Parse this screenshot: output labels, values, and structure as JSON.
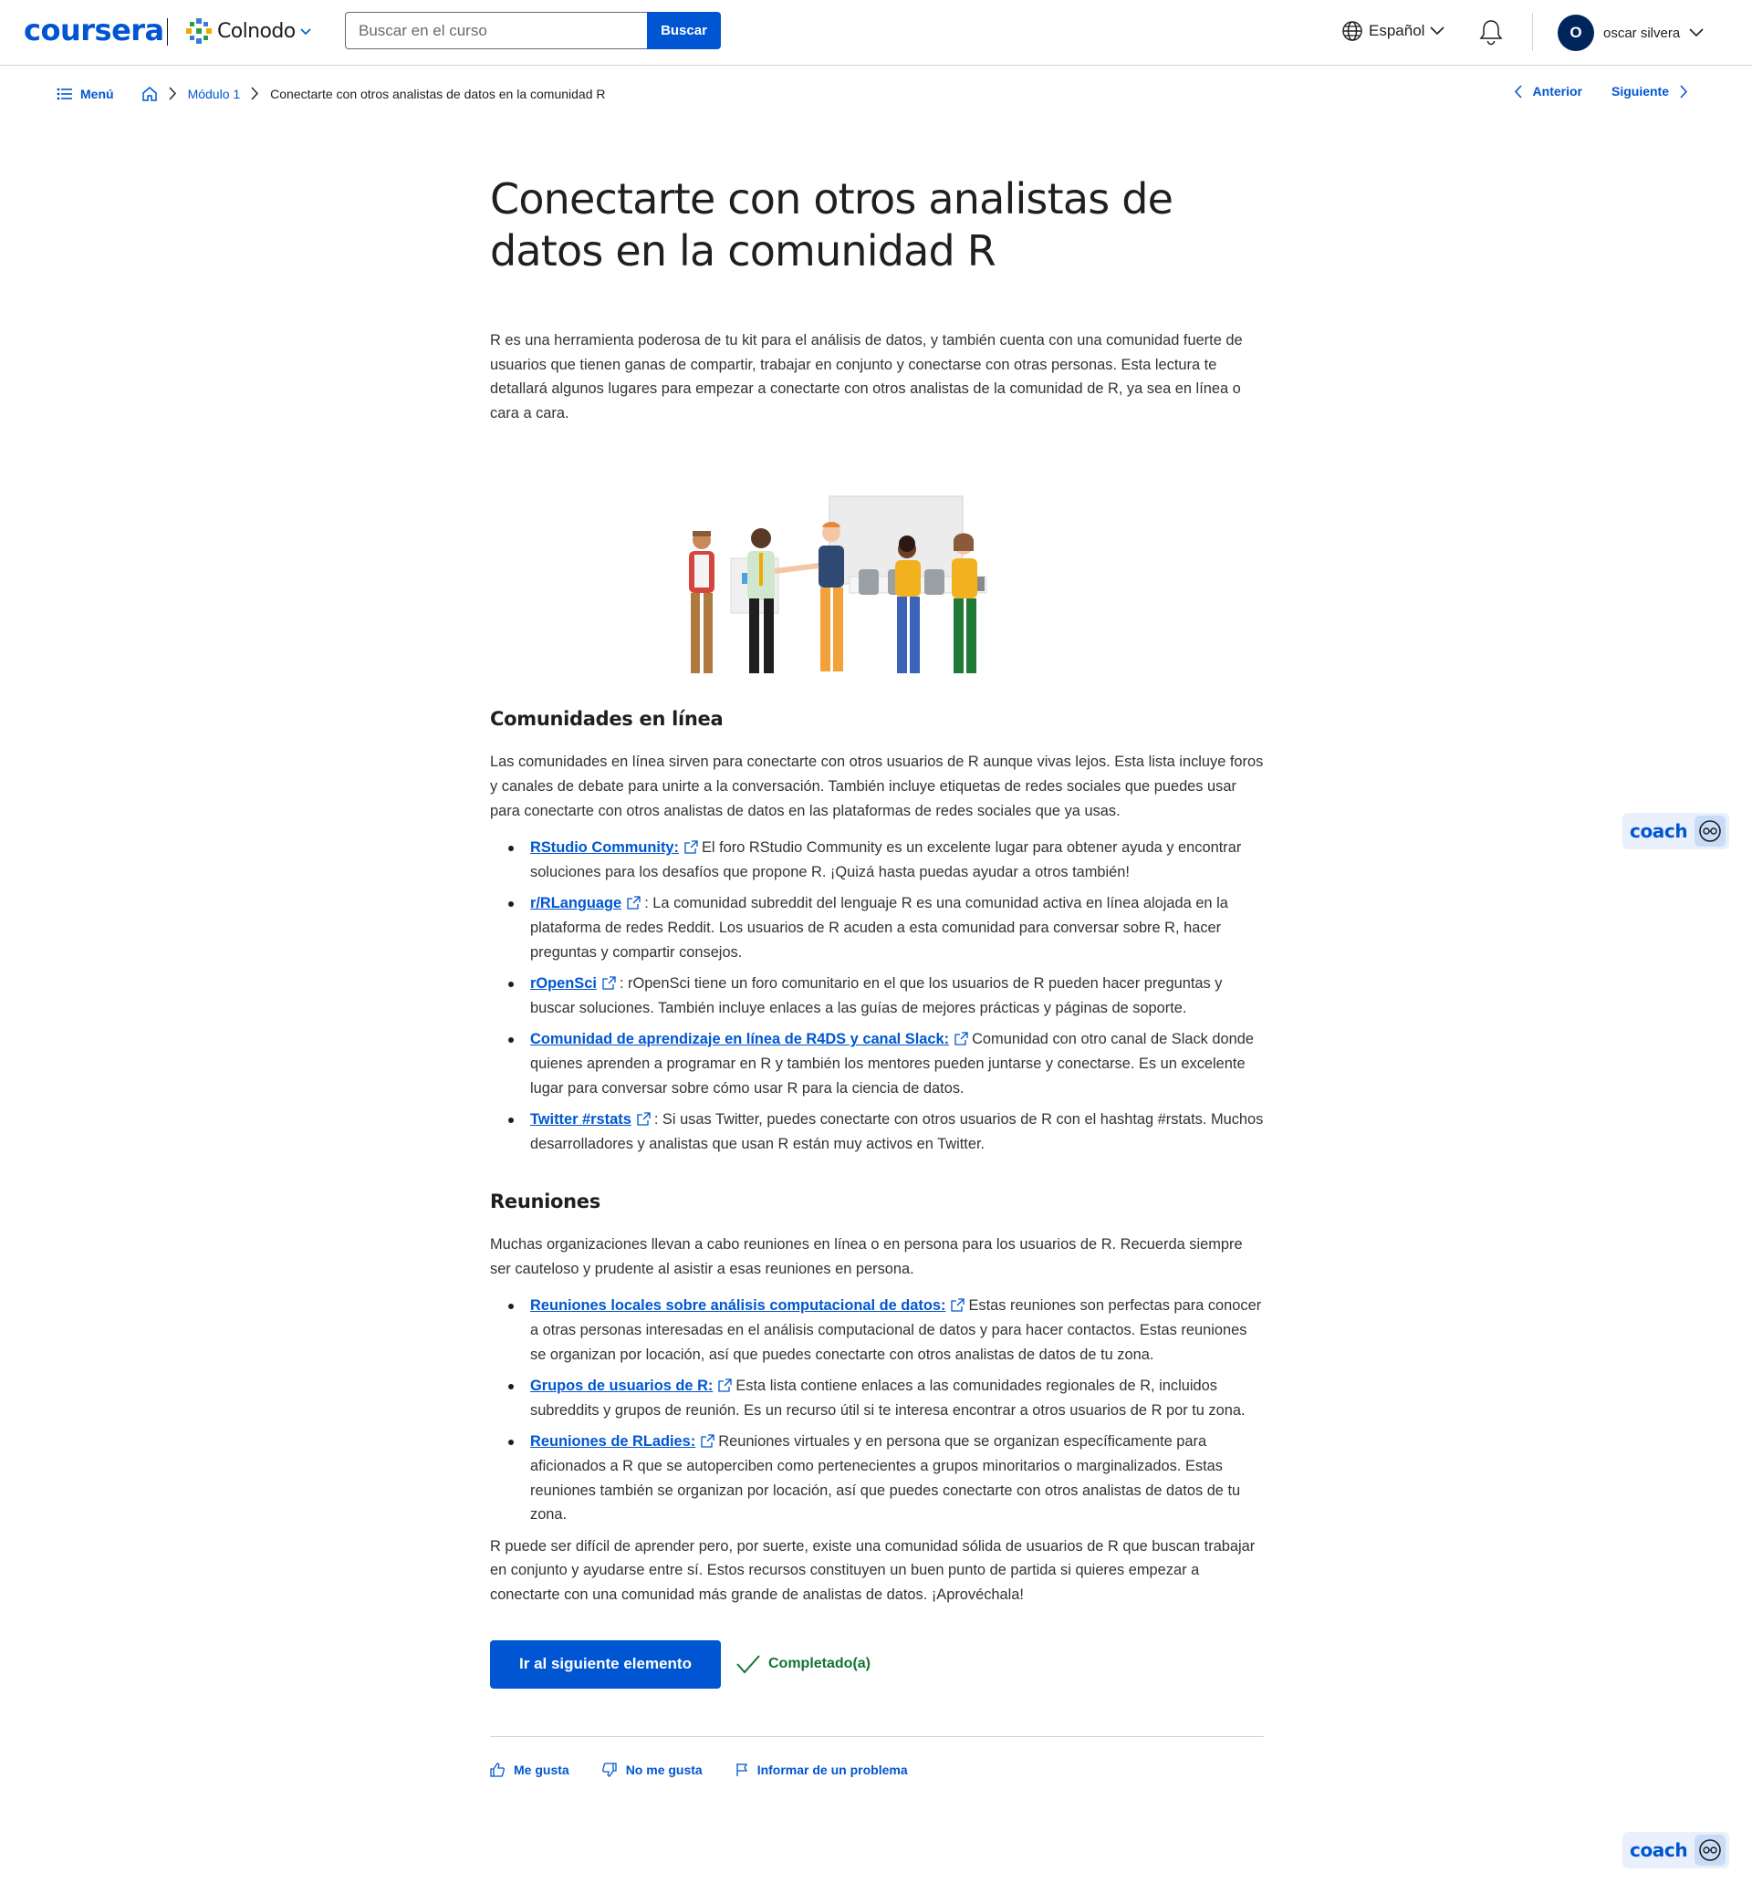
{
  "header": {
    "logo": "coursera",
    "partner": "Colnodo",
    "search_placeholder": "Buscar en el curso",
    "search_button": "Buscar",
    "language": "Español",
    "user_initial": "O",
    "user_name": "oscar silvera",
    "brand_color": "#0056d2"
  },
  "breadcrumb": {
    "menu": "Menú",
    "module": "Módulo 1",
    "current": "Conectarte con otros analistas de datos en la comunidad R"
  },
  "nav": {
    "previous": "Anterior",
    "next": "Siguiente"
  },
  "article": {
    "title": "Conectarte con otros analistas de datos en la comunidad R",
    "intro": "R es una herramienta poderosa de tu kit para el análisis de datos, y también cuenta con una comunidad fuerte de usuarios que tienen ganas de compartir, trabajar en conjunto y conectarse con otras personas. Esta lectura te detallará algunos lugares para empezar a conectarte con otros analistas de la comunidad de R, ya sea en línea o cara a cara.",
    "online": {
      "heading": "Comunidades en línea",
      "text": "Las comunidades en línea sirven para conectarte con otros usuarios de R aunque vivas lejos. Esta lista incluye foros y canales de debate para unirte a la conversación. También incluye etiquetas de redes sociales que puedes usar para conectarte con otros analistas de datos en las plataformas de redes sociales que ya usas.",
      "items": [
        {
          "link": "RStudio Community:",
          "text": "El foro RStudio Community es un excelente lugar para obtener ayuda y encontrar soluciones para los desafíos que propone R. ¡Quizá hasta puedas ayudar a otros también!"
        },
        {
          "link": "r/RLanguage",
          "text": ": La comunidad subreddit del lenguaje R es una comunidad activa en línea alojada en la plataforma de redes Reddit. Los usuarios de R acuden a esta comunidad para conversar sobre R, hacer preguntas y compartir consejos."
        },
        {
          "link": "rOpenSci",
          "text": ": rOpenSci tiene un foro comunitario en el que los usuarios de R pueden hacer preguntas y buscar soluciones. También incluye enlaces a las guías de mejores prácticas y páginas de soporte."
        },
        {
          "link": "Comunidad de aprendizaje en línea de R4DS y canal Slack:",
          "text": "Comunidad con otro canal de Slack donde quienes aprenden a programar en R y también los mentores pueden juntarse y conectarse. Es un excelente lugar para conversar sobre cómo usar R para la ciencia de datos."
        },
        {
          "link": "Twitter #rstats",
          "text": ": Si usas Twitter, puedes conectarte con otros usuarios de R con el hashtag #rstats. Muchos desarrolladores y analistas que usan R están muy activos en Twitter."
        }
      ]
    },
    "meetups": {
      "heading": "Reuniones",
      "text": "Muchas organizaciones llevan a cabo reuniones en línea o en persona para los usuarios de R. Recuerda siempre ser cauteloso y prudente al asistir a esas reuniones en persona.",
      "items": [
        {
          "link": "Reuniones locales sobre análisis computacional de datos:",
          "text": "Estas reuniones son perfectas para conocer a otras personas interesadas en el análisis computacional de datos y para hacer contactos. Estas reuniones se organizan por locación, así que puedes conectarte con otros analistas de datos de tu zona."
        },
        {
          "link": "Grupos de usuarios de R:",
          "text": "Esta lista contiene enlaces a las comunidades regionales de R, incluidos subreddits y grupos de reunión. Es un recurso útil si te interesa encontrar a otros usuarios de R por tu zona."
        },
        {
          "link": "Reuniones de RLadies:",
          "text": "Reuniones virtuales y en persona que se organizan específicamente para aficionados a R que se autoperciben como pertenecientes a grupos minoritarios o marginalizados. Estas reuniones también se organizan por locación, así que puedes conectarte con otros analistas de datos de tu zona."
        }
      ]
    },
    "closing": "R puede ser difícil de aprender pero, por suerte, existe una comunidad sólida de usuarios de R que buscan trabajar en conjunto y ayudarse entre sí. Estos recursos constituyen un buen punto de partida si quieres empezar a conectarte con una comunidad más grande de analistas de datos. ¡Aprovéchala!"
  },
  "actions": {
    "next_item": "Ir al siguiente elemento",
    "completed": "Completado(a)",
    "completed_color": "#137333"
  },
  "feedback": {
    "like": "Me gusta",
    "dislike": "No me gusta",
    "report": "Informar de un problema"
  },
  "coach": {
    "label": "coach"
  }
}
